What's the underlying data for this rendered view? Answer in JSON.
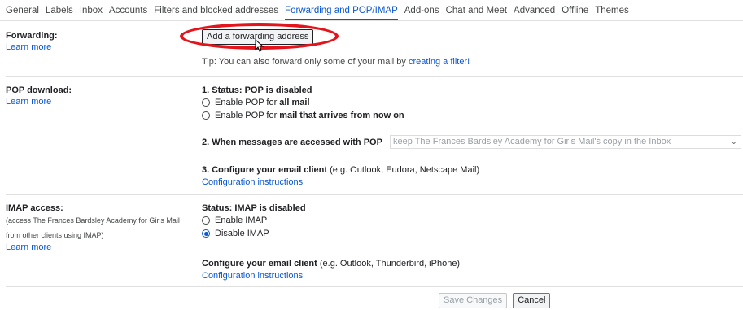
{
  "tabs": [
    {
      "label": "General"
    },
    {
      "label": "Labels"
    },
    {
      "label": "Inbox"
    },
    {
      "label": "Accounts"
    },
    {
      "label": "Filters and blocked addresses"
    },
    {
      "label": "Forwarding and POP/IMAP",
      "active": true
    },
    {
      "label": "Add-ons"
    },
    {
      "label": "Chat and Meet"
    },
    {
      "label": "Advanced"
    },
    {
      "label": "Offline"
    },
    {
      "label": "Themes"
    }
  ],
  "forwarding": {
    "title": "Forwarding:",
    "learn_more": "Learn more",
    "add_button": "Add a forwarding address",
    "tip_text": "Tip: You can also forward only some of your mail by ",
    "tip_link": "creating a filter!"
  },
  "pop": {
    "title": "POP download:",
    "learn_more": "Learn more",
    "status_label": "1. Status: POP is disabled",
    "option1_prefix": "Enable POP for ",
    "option1_bold": "all mail",
    "option2_prefix": "Enable POP for ",
    "option2_bold": "mail that arrives from now on",
    "when_label": "2. When messages are accessed with POP",
    "when_select": "keep The Frances Bardsley Academy for Girls Mail's copy in the Inbox",
    "configure_bold": "3. Configure your email client",
    "configure_rest": " (e.g. Outlook, Eudora, Netscape Mail)",
    "config_link": "Configuration instructions"
  },
  "imap": {
    "title": "IMAP access:",
    "note_line1": "(access The Frances Bardsley Academy for Girls Mail",
    "note_line2": "from other clients using IMAP)",
    "learn_more": "Learn more",
    "status_label": "Status: IMAP is disabled",
    "enable": "Enable IMAP",
    "disable": "Disable IMAP",
    "selected": "disable",
    "configure_bold": "Configure your email client",
    "configure_rest": " (e.g. Outlook, Thunderbird, iPhone)",
    "config_link": "Configuration instructions"
  },
  "footer": {
    "save": "Save Changes",
    "cancel": "Cancel"
  },
  "colors": {
    "accent": "#0b57d0",
    "highlight_ellipse": "#e3141b"
  }
}
